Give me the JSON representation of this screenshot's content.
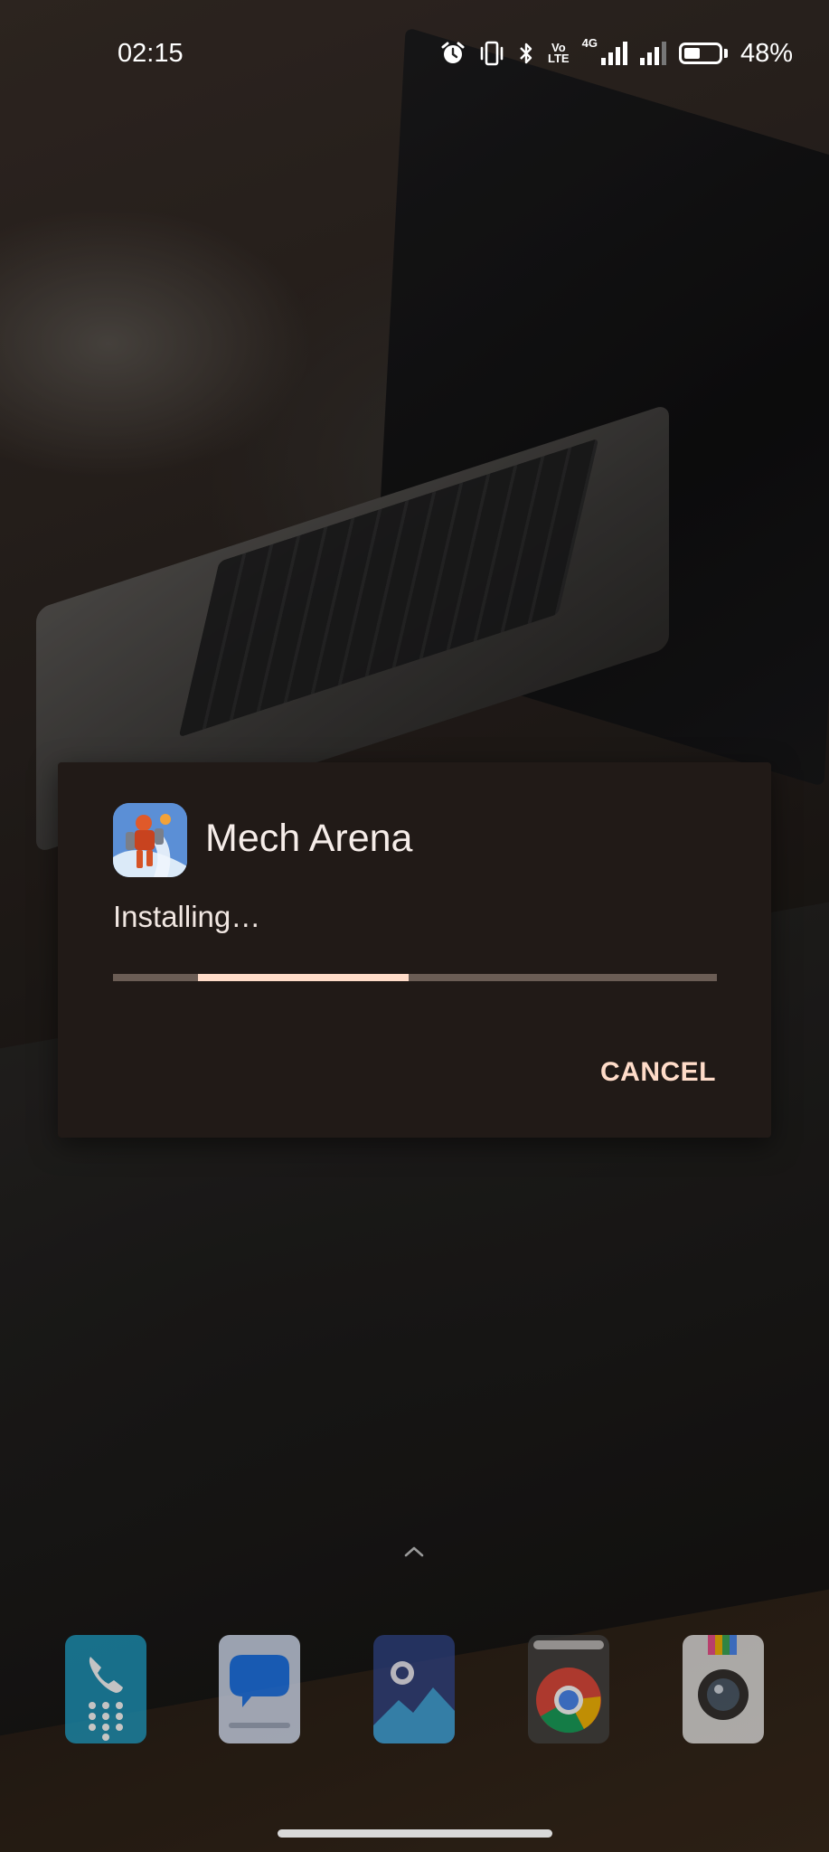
{
  "status_bar": {
    "time": "02:15",
    "volte_label_top": "Vo",
    "volte_label_bottom": "LTE",
    "network_label": "4G",
    "battery_percent": "48%",
    "battery_level": 0.48,
    "icons": [
      "alarm-icon",
      "vibrate-icon",
      "bluetooth-icon",
      "volte-icon",
      "data-4g-icon",
      "signal-icon",
      "battery-icon"
    ]
  },
  "dialog": {
    "app_name": "Mech Arena",
    "app_icon": "mech-arena-app-icon",
    "status_text": "Installing…",
    "progress": {
      "indeterminate": true,
      "segment_start": 0.14,
      "segment_end": 0.49
    },
    "cancel_label": "CANCEL",
    "colors": {
      "background": "#211a17",
      "accent": "#ffdcc9",
      "track": "#6b5d55",
      "text": "#f6ede9"
    }
  },
  "home": {
    "drawer_icon": "chevron-up-icon",
    "dock": [
      {
        "app": "phone",
        "icon": "phone-dialer-icon",
        "color": "#1a8fb3"
      },
      {
        "app": "messages",
        "icon": "messages-icon",
        "color": "#c9d3e6"
      },
      {
        "app": "gallery",
        "icon": "gallery-icon",
        "color": "#2b3d7a"
      },
      {
        "app": "chrome",
        "icon": "chrome-icon",
        "color": "#3c3c3c"
      },
      {
        "app": "camera",
        "icon": "camera-icon",
        "color": "#d8d8d8"
      }
    ]
  }
}
